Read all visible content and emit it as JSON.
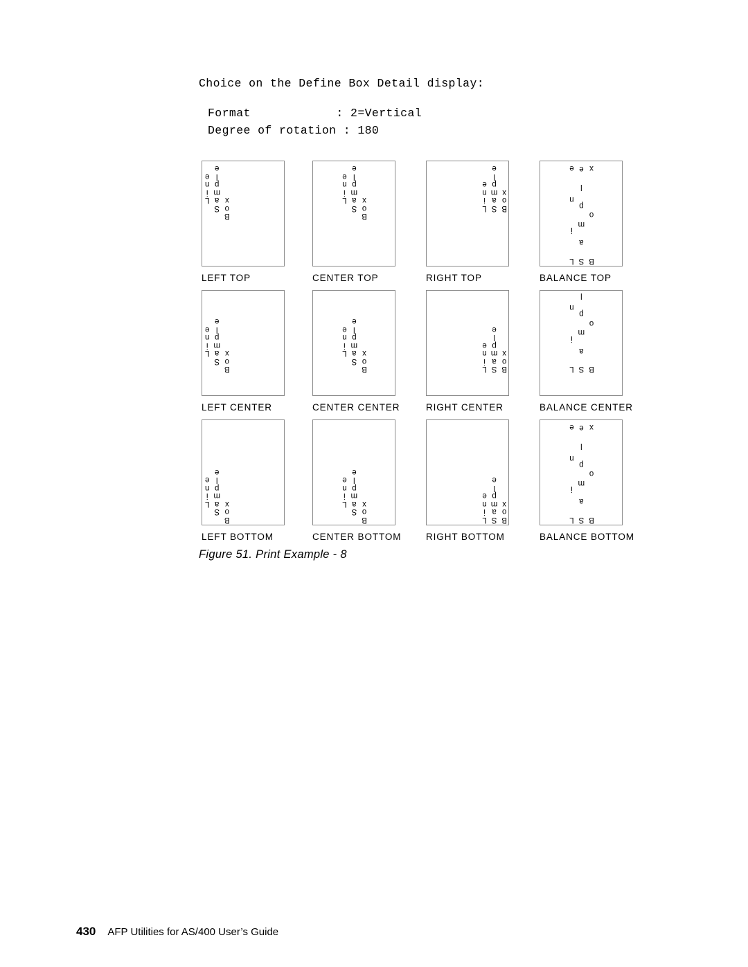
{
  "heading": {
    "title": "Choice on the Define Box Detail display:",
    "fields": [
      "Format            : 2=Vertical",
      "Degree of rotation : 180"
    ]
  },
  "figure": {
    "rotation_degrees": 180,
    "sample_words": [
      "Box",
      "Sample",
      "Line"
    ],
    "rows": [
      {
        "vertical": "top",
        "cells": [
          {
            "label": "LEFT TOP",
            "horizontal": "right",
            "vertical": "bottom",
            "mode": "stack",
            "columns": [
              {
                "text": "Box",
                "offset": 0
              },
              {
                "text": "Sample",
                "offset": 1
              },
              {
                "text": "Line",
                "offset": 2
              }
            ]
          },
          {
            "label": "CENTER TOP",
            "horizontal": "center",
            "vertical": "bottom",
            "mode": "stack",
            "columns": [
              {
                "text": "Box",
                "offset": 0
              },
              {
                "text": "Sample",
                "offset": 1
              },
              {
                "text": "Line",
                "offset": 2
              }
            ]
          },
          {
            "label": "RIGHT TOP",
            "horizontal": "left",
            "vertical": "bottom",
            "mode": "stack",
            "columns": [
              {
                "text": "Box",
                "offset": 0
              },
              {
                "text": "Sample",
                "offset": 0
              },
              {
                "text": "Line",
                "offset": 0
              }
            ]
          },
          {
            "label": "BALANCE TOP",
            "horizontal": "center",
            "vertical": "bottom",
            "mode": "balance",
            "columns": [
              {
                "text": "Box",
                "offset": 0
              },
              {
                "text": "Sample",
                "offset": 0
              },
              {
                "text": "Line",
                "offset": 0
              }
            ]
          }
        ]
      },
      {
        "vertical": "center",
        "cells": [
          {
            "label": "LEFT CENTER",
            "horizontal": "right",
            "vertical": "center",
            "mode": "stack",
            "columns": [
              {
                "text": "Box",
                "offset": 0
              },
              {
                "text": "Sample",
                "offset": 1
              },
              {
                "text": "Line",
                "offset": 2
              }
            ]
          },
          {
            "label": "CENTER CENTER",
            "horizontal": "center",
            "vertical": "center",
            "mode": "stack",
            "columns": [
              {
                "text": "Box",
                "offset": 0
              },
              {
                "text": "Sample",
                "offset": 1
              },
              {
                "text": "Line",
                "offset": 2
              }
            ]
          },
          {
            "label": "RIGHT CENTER",
            "horizontal": "left",
            "vertical": "center",
            "mode": "stack",
            "columns": [
              {
                "text": "Box",
                "offset": 0
              },
              {
                "text": "Sample",
                "offset": 0
              },
              {
                "text": "Line",
                "offset": 0
              }
            ]
          },
          {
            "label": "BALANCE CENTER",
            "horizontal": "center",
            "vertical": "center",
            "mode": "balance",
            "columns": [
              {
                "text": "Box",
                "offset": 0
              },
              {
                "text": "Sample",
                "offset": 0
              },
              {
                "text": "Line",
                "offset": 0
              }
            ]
          }
        ]
      },
      {
        "vertical": "bottom",
        "cells": [
          {
            "label": "LEFT BOTTOM",
            "horizontal": "right",
            "vertical": "top",
            "mode": "stack",
            "columns": [
              {
                "text": "Box",
                "offset": 0
              },
              {
                "text": "Sample",
                "offset": 1
              },
              {
                "text": "Line",
                "offset": 2
              }
            ]
          },
          {
            "label": "CENTER BOTTOM",
            "horizontal": "center",
            "vertical": "top",
            "mode": "stack",
            "columns": [
              {
                "text": "Box",
                "offset": 0
              },
              {
                "text": "Sample",
                "offset": 1
              },
              {
                "text": "Line",
                "offset": 2
              }
            ]
          },
          {
            "label": "RIGHT BOTTOM",
            "horizontal": "left",
            "vertical": "top",
            "mode": "stack",
            "columns": [
              {
                "text": "Box",
                "offset": 0
              },
              {
                "text": "Sample",
                "offset": 0
              },
              {
                "text": "Line",
                "offset": 0
              }
            ]
          },
          {
            "label": "BALANCE BOTTOM",
            "horizontal": "center",
            "vertical": "top",
            "mode": "balance",
            "columns": [
              {
                "text": "Box",
                "offset": 0
              },
              {
                "text": "Sample",
                "offset": 0
              },
              {
                "text": "Line",
                "offset": 0
              }
            ]
          }
        ]
      }
    ],
    "caption": "Figure 51. Print Example - 8"
  },
  "footer": {
    "page_number": "430",
    "title": "AFP Utilities for AS/400 User’s Guide"
  },
  "colors": {
    "text": "#000000",
    "box_border": "#8a8a8a",
    "page_background": "#ffffff"
  }
}
